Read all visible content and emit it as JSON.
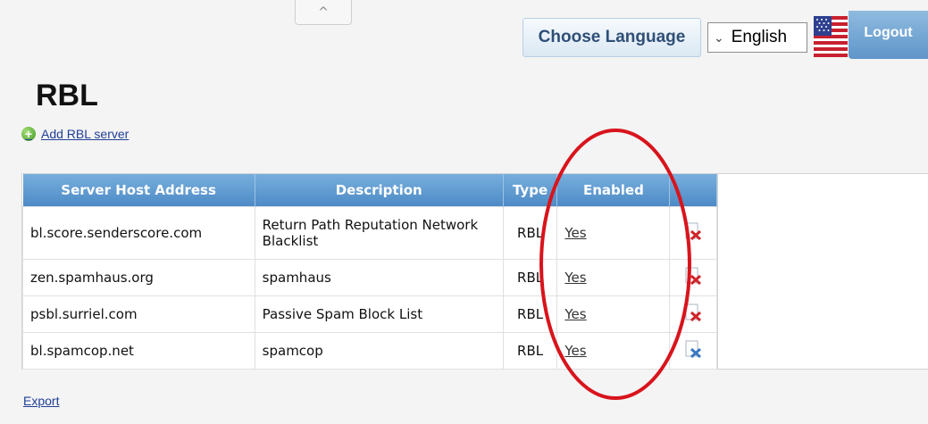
{
  "header": {
    "collapse_glyph": "^",
    "choose_language_label": "Choose Language",
    "language_select": {
      "selected": "English"
    },
    "logout_label": "Logout"
  },
  "page": {
    "title": "RBL",
    "add_link_label": "Add RBL server",
    "export_label": "Export"
  },
  "table": {
    "columns": [
      "Server Host Address",
      "Description",
      "Type",
      "Enabled"
    ],
    "rows": [
      {
        "host": "bl.score.senderscore.com",
        "description": "Return Path Reputation Network Blacklist",
        "type": "RBL",
        "enabled": "Yes"
      },
      {
        "host": "zen.spamhaus.org",
        "description": "spamhaus",
        "type": "RBL",
        "enabled": "Yes"
      },
      {
        "host": "psbl.surriel.com",
        "description": "Passive Spam Block List",
        "type": "RBL",
        "enabled": "Yes"
      },
      {
        "host": "bl.spamcop.net",
        "description": "spamcop",
        "type": "RBL",
        "enabled": "Yes"
      }
    ]
  },
  "icons": {
    "flag": "us-flag-icon",
    "add": "plus-icon",
    "delete": "delete-icon",
    "collapse": "chevron-up-icon"
  },
  "colors": {
    "header_blue": "#5d9bd3",
    "link_blue": "#1f3f97",
    "highlight_red": "#d8141c"
  }
}
